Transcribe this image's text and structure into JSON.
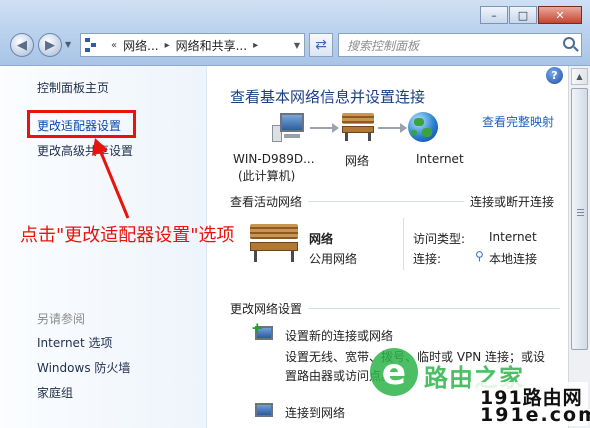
{
  "address_bar": {
    "crumbs": [
      "网络...",
      "网络和共享..."
    ],
    "search_placeholder": "搜索控制面板"
  },
  "window_controls": {
    "minimize": "–",
    "maximize": "□",
    "close": "✕"
  },
  "left_pane": {
    "home": "控制面板主页",
    "links": [
      "更改适配器设置",
      "更改高级共享设置"
    ],
    "see_also_title": "另请参阅",
    "see_also": [
      "Internet 选项",
      "Windows 防火墙",
      "家庭组"
    ]
  },
  "annotation": {
    "text": "点击\"更改适配器设置\"选项"
  },
  "main": {
    "title": "查看基本网络信息并设置连接",
    "full_map_link": "查看完整映射",
    "map": {
      "computer_name": "WIN-D989D...",
      "computer_sub": "(此计算机)",
      "network": "网络",
      "internet": "Internet"
    },
    "active_networks": {
      "title": "查看活动网络",
      "connect_link": "连接或断开连接",
      "network_name": "网络",
      "network_type": "公用网络",
      "access_type_label": "访问类型:",
      "access_type_value": "Internet",
      "connection_label": "连接:",
      "connection_value": "本地连接"
    },
    "change_settings": {
      "title": "更改网络设置",
      "item1_title": "设置新的连接或网络",
      "item1_desc_line1": "设置无线、宽带、拨号、临时或 VPN 连接；或设",
      "item1_desc_line2": "置路由器或访问点。",
      "item2_title": "连接到网络"
    }
  },
  "watermarks": {
    "logo_text": "路由之家",
    "site_line1": "191路由网",
    "site_line2": "191e.com"
  }
}
